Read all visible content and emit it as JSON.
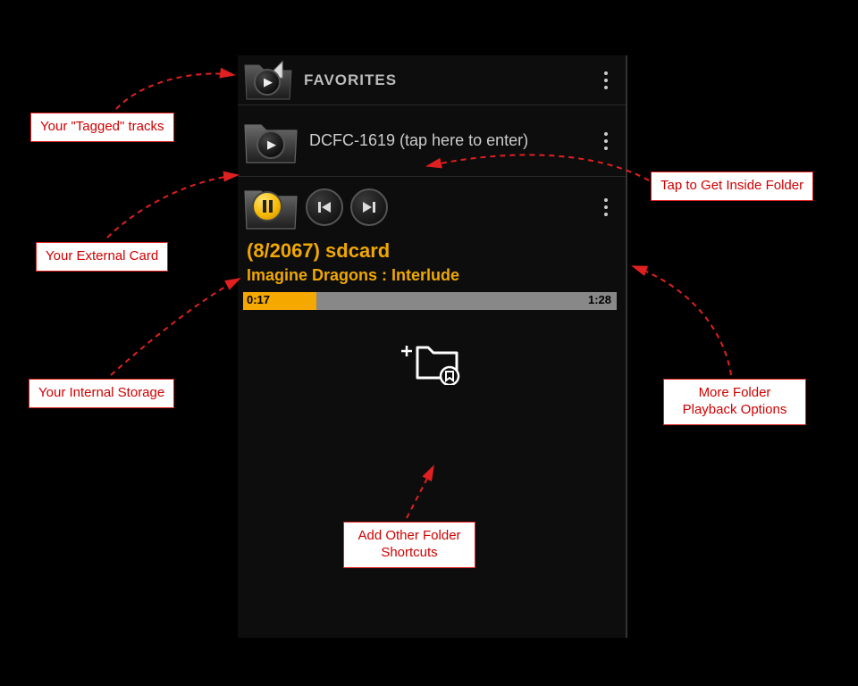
{
  "rows": {
    "favorites": {
      "label": "FAVORITES"
    },
    "folder": {
      "label": "DCFC-1619 (tap here to enter)"
    },
    "sdcard": {
      "count_label": "(8/2067)  sdcard",
      "track": "Imagine Dragons : Interlude",
      "elapsed": "0:17",
      "duration": "1:28"
    }
  },
  "callouts": {
    "tagged": "Your \"Tagged\" tracks",
    "external": "Your External Card",
    "internal": "Your Internal Storage",
    "inside": "Tap to Get Inside Folder",
    "more": "More Folder Playback Options",
    "add": "Add Other Folder Shortcuts"
  }
}
